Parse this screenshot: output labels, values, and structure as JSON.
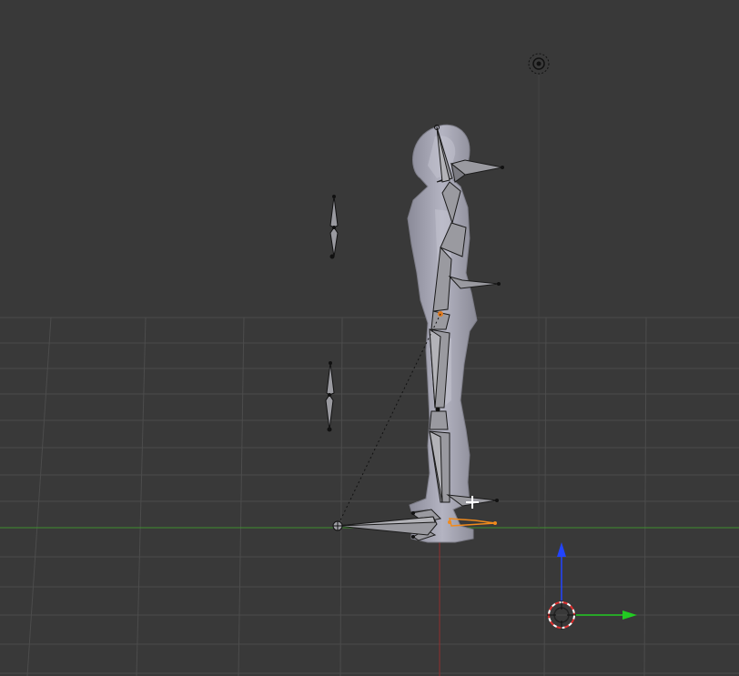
{
  "viewport": {
    "name": "3D Viewport",
    "background_color": "#393939",
    "grid_color": "#4a4a4a",
    "x_axis_color": "#3f8f2f",
    "z_axis_color": "#8f2f2f"
  },
  "scene": {
    "light": {
      "icon": "sun-lamp-icon"
    },
    "mesh": {
      "name": "character-mesh",
      "color": "#9a9aa8"
    },
    "armature": {
      "bone_color": "#9a9aa0",
      "selected_bone_color": "#f08a1c"
    },
    "cursor": {
      "icon": "3d-cursor-icon"
    },
    "ik_target_line": "dashed"
  },
  "manipulator": {
    "icon": "transform-manipulator-icon",
    "z_arrow_color": "#2244ff",
    "y_arrow_color": "#22cc22"
  }
}
